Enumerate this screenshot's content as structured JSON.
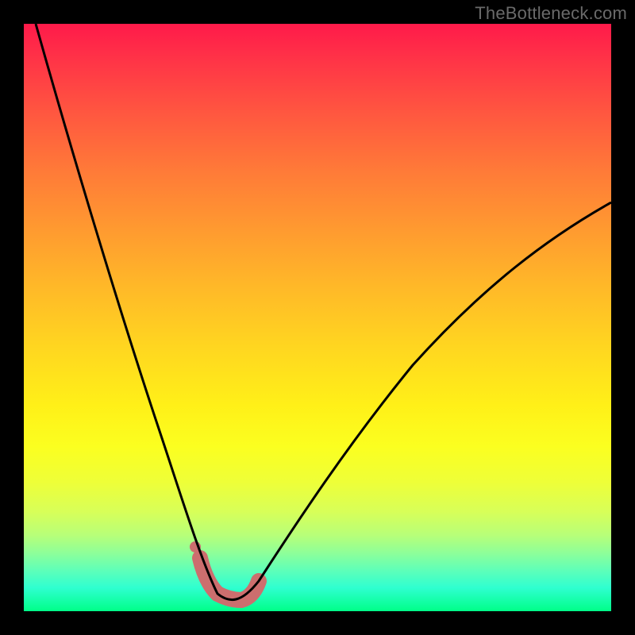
{
  "watermark": "TheBottleneck.com",
  "colors": {
    "background_frame": "#000000",
    "gradient_top": "#ff1a4a",
    "gradient_bottom": "#00ff88",
    "curve_stroke": "#000000",
    "throat_stroke": "#cc6e6e"
  },
  "chart_data": {
    "type": "line",
    "title": "",
    "xlabel": "",
    "ylabel": "",
    "xlim": [
      0,
      100
    ],
    "ylim": [
      0,
      100
    ],
    "grid": false,
    "legend": false,
    "series": [
      {
        "name": "bottleneck-curve",
        "x": [
          2,
          6,
          10,
          14,
          18,
          22,
          26,
          29,
          31,
          33,
          35,
          37,
          39,
          42,
          46,
          52,
          58,
          66,
          74,
          82,
          90,
          100
        ],
        "y": [
          100,
          82,
          66,
          52,
          40,
          29,
          19,
          12,
          8,
          5,
          3,
          2,
          2,
          3,
          6,
          12,
          20,
          30,
          40,
          49,
          57,
          65
        ]
      }
    ],
    "annotations": [
      {
        "name": "throat-highlight",
        "type": "segment",
        "x": [
          30,
          31,
          33,
          35,
          37,
          39,
          40
        ],
        "y": [
          9,
          5,
          3,
          2,
          2,
          3,
          5
        ],
        "stroke_width_px": 20,
        "stroke": "#cc6e6e"
      },
      {
        "name": "throat-dot",
        "type": "point",
        "x": 29.2,
        "y": 11,
        "radius_px": 7,
        "fill": "#cc6e6e"
      }
    ],
    "notes": "Values estimated from pixel positions. y=0 is bottom of plot area, y=100 is top. Curve is a V-shaped bottleneck profile with minimum near x≈37."
  }
}
